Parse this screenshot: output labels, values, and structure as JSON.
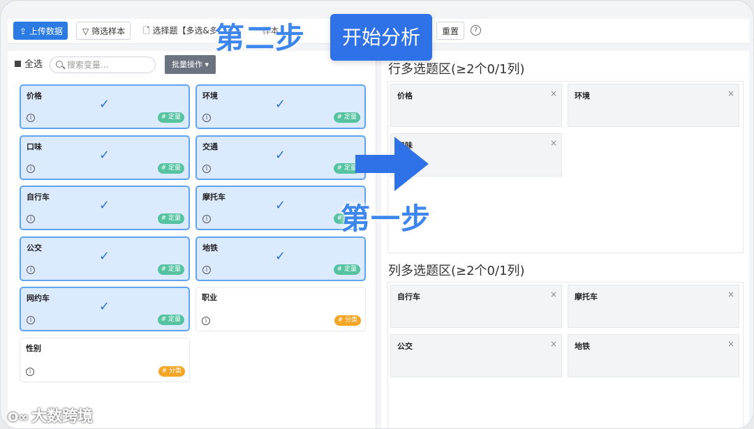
{
  "toolbar": {
    "upload_label": "上传数据",
    "filter_label": "筛选样本",
    "type_label": "选择题【多选&多",
    "type_label_tail": "样本",
    "reset_label": "重置",
    "help_icon": "question-circle-icon"
  },
  "overlay": {
    "step2": "第二步",
    "start_button": "开始分析",
    "step1": "第一步",
    "watermark": "大数跨境"
  },
  "left": {
    "select_all": "全选",
    "search_placeholder": "搜索变量...",
    "batch_label": "批量操作 ▾",
    "variables": [
      {
        "name": "价格",
        "selected": true,
        "tag": "# 定量"
      },
      {
        "name": "环境",
        "selected": true,
        "tag": "# 定量"
      },
      {
        "name": "口味",
        "selected": true,
        "tag": "# 定量"
      },
      {
        "name": "交通",
        "selected": true,
        "tag": "# 定量"
      },
      {
        "name": "自行车",
        "selected": true,
        "tag": "# 定量"
      },
      {
        "name": "摩托车",
        "selected": true,
        "tag": "# 定量"
      },
      {
        "name": "公交",
        "selected": true,
        "tag": "# 定量"
      },
      {
        "name": "地铁",
        "selected": true,
        "tag": "# 定量"
      },
      {
        "name": "网约车",
        "selected": true,
        "tag": "# 定量"
      },
      {
        "name": "职业",
        "selected": false,
        "tag": "# 分类"
      },
      {
        "name": "性别",
        "selected": false,
        "tag": "# 分类"
      }
    ]
  },
  "right": {
    "row_zone_title": "行多选题区(≥2个0/1列)",
    "row_items": [
      "价格",
      "环境",
      "口味"
    ],
    "col_zone_title": "列多选题区(≥2个0/1列)",
    "col_items": [
      "自行车",
      "摩托车",
      "公交",
      "地铁"
    ]
  }
}
